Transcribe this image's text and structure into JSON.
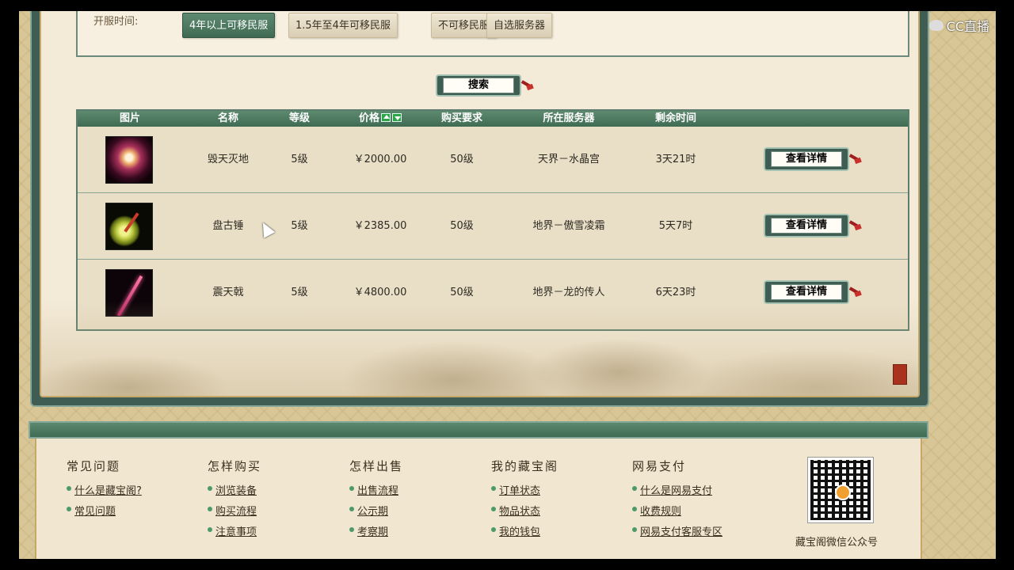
{
  "watermark": "CC直播",
  "filter": {
    "label": "开服时间:",
    "options": [
      "4年以上可移民服",
      "1.5年至4年可移民服",
      "不可移民服",
      "自选服务器"
    ],
    "active_index": 0
  },
  "search_label": "搜索",
  "table": {
    "headers": [
      "图片",
      "名称",
      "等级",
      "价格",
      "购买要求",
      "所在服务器",
      "剩余时间"
    ],
    "rows": [
      {
        "name": "毁天灭地",
        "level": "5级",
        "price": "￥2000.00",
        "requirement": "50级",
        "server": "天界－水晶宫",
        "time_left": "3天21时",
        "action": "查看详情"
      },
      {
        "name": "盘古锤",
        "level": "5级",
        "price": "￥2385.00",
        "requirement": "50级",
        "server": "地界－傲雪凌霜",
        "time_left": "5天7时",
        "action": "查看详情"
      },
      {
        "name": "震天戟",
        "level": "5级",
        "price": "￥4800.00",
        "requirement": "50级",
        "server": "地界－龙的传人",
        "time_left": "6天23时",
        "action": "查看详情"
      }
    ]
  },
  "footer": {
    "columns": [
      {
        "title": "常见问题",
        "links": [
          "什么是藏宝阁?",
          "常见问题"
        ]
      },
      {
        "title": "怎样购买",
        "links": [
          "浏览装备",
          "购买流程",
          "注意事项"
        ]
      },
      {
        "title": "怎样出售",
        "links": [
          "出售流程",
          "公示期",
          "考察期"
        ]
      },
      {
        "title": "我的藏宝阁",
        "links": [
          "订单状态",
          "物品状态",
          "我的钱包"
        ]
      },
      {
        "title": "网易支付",
        "links": [
          "什么是网易支付",
          "收费规则",
          "网易支付客服专区"
        ]
      }
    ],
    "qr_caption": "藏宝阁微信公众号"
  }
}
